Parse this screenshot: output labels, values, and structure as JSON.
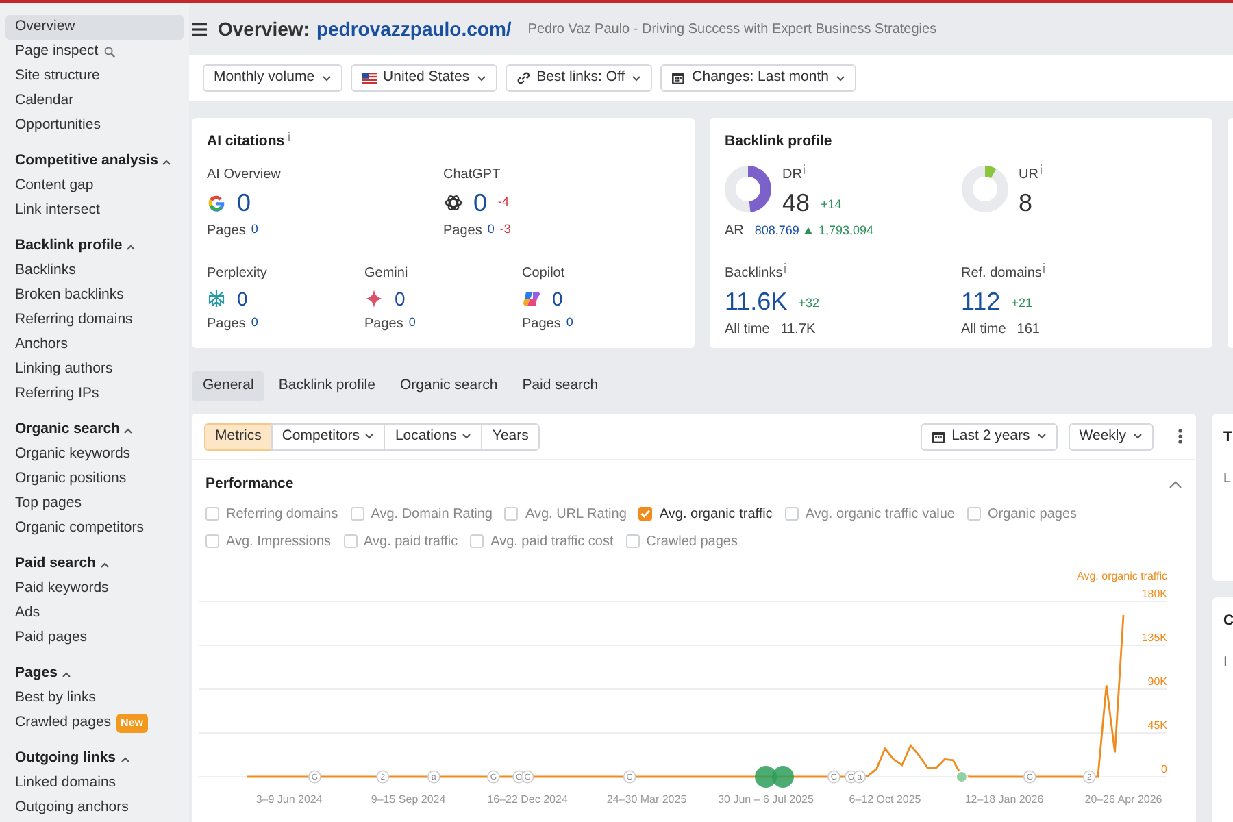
{
  "sidebar": {
    "groups": [
      {
        "items": [
          {
            "label": "Overview",
            "selected": true,
            "kind": "link"
          },
          {
            "label": "Page inspect",
            "selected": false,
            "kind": "search_link"
          },
          {
            "label": "Site structure",
            "selected": false,
            "kind": "link"
          },
          {
            "label": "Calendar",
            "selected": false,
            "kind": "link"
          },
          {
            "label": "Opportunities",
            "selected": false,
            "kind": "link"
          }
        ]
      },
      {
        "title": "Competitive analysis",
        "expanded": true,
        "items": [
          {
            "label": "Content gap",
            "selected": false,
            "kind": "link"
          },
          {
            "label": "Link intersect",
            "selected": false,
            "kind": "link"
          }
        ]
      },
      {
        "title": "Backlink profile",
        "expanded": true,
        "items": [
          {
            "label": "Backlinks",
            "selected": false,
            "kind": "link"
          },
          {
            "label": "Broken backlinks",
            "selected": false,
            "kind": "link"
          },
          {
            "label": "Referring domains",
            "selected": false,
            "kind": "link"
          },
          {
            "label": "Anchors",
            "selected": false,
            "kind": "link"
          },
          {
            "label": "Linking authors",
            "selected": false,
            "kind": "link"
          },
          {
            "label": "Referring IPs",
            "selected": false,
            "kind": "link"
          }
        ]
      },
      {
        "title": "Organic search",
        "expanded": true,
        "items": [
          {
            "label": "Organic keywords",
            "selected": false,
            "kind": "link"
          },
          {
            "label": "Organic positions",
            "selected": false,
            "kind": "link"
          },
          {
            "label": "Top pages",
            "selected": false,
            "kind": "link"
          },
          {
            "label": "Organic competitors",
            "selected": false,
            "kind": "link"
          }
        ]
      },
      {
        "title": "Paid search",
        "expanded": true,
        "items": [
          {
            "label": "Paid keywords",
            "selected": false,
            "kind": "link"
          },
          {
            "label": "Ads",
            "selected": false,
            "kind": "link"
          },
          {
            "label": "Paid pages",
            "selected": false,
            "kind": "link"
          }
        ]
      },
      {
        "title": "Pages",
        "expanded": true,
        "items": [
          {
            "label": "Best by links",
            "selected": false,
            "kind": "link"
          },
          {
            "label": "Crawled pages",
            "selected": false,
            "kind": "link",
            "badge": "New"
          }
        ]
      },
      {
        "title": "Outgoing links",
        "expanded": true,
        "items": [
          {
            "label": "Linked domains",
            "selected": false,
            "kind": "link"
          },
          {
            "label": "Outgoing anchors",
            "selected": false,
            "kind": "link"
          }
        ]
      }
    ]
  },
  "header": {
    "title": "Overview:",
    "domain": "pedrovazzpaulo.com/",
    "subtitle": "Pedro Vaz Paulo - Driving Success with Expert Business Strategies"
  },
  "filters": [
    {
      "label": "Monthly volume",
      "kind": "plain"
    },
    {
      "label": "United States",
      "kind": "flag"
    },
    {
      "label": "Best links: Off",
      "kind": "link"
    },
    {
      "label": "Changes: Last month",
      "kind": "calendar"
    }
  ],
  "ai_citations": {
    "title": "AI citations",
    "sources": [
      {
        "name": "AI Overview",
        "kind": "google",
        "value": "0",
        "pages_label": "Pages",
        "pages": "0"
      },
      {
        "name": "ChatGPT",
        "kind": "chatgpt",
        "value": "0",
        "delta": "-4",
        "pages_label": "Pages",
        "pages": "0",
        "pages_delta": "-3"
      },
      {
        "name": "Perplexity",
        "kind": "perplexity",
        "value": "0",
        "pages_label": "Pages",
        "pages": "0"
      },
      {
        "name": "Gemini",
        "kind": "gemini",
        "value": "0",
        "pages_label": "Pages",
        "pages": "0"
      },
      {
        "name": "Copilot",
        "kind": "copilot",
        "value": "0",
        "pages_label": "Pages",
        "pages": "0"
      }
    ]
  },
  "backlink_profile": {
    "title": "Backlink profile",
    "ratings": [
      {
        "label": "DR",
        "value": "48",
        "delta": "+14",
        "level": 0.48,
        "color": "#7b61c9"
      },
      {
        "label": "UR",
        "value": "8",
        "level": 0.08,
        "color": "#8cc63f"
      }
    ],
    "ar": {
      "label": "AR",
      "value": "808,769",
      "delta": "1,793,094"
    },
    "stats": [
      {
        "label": "Backlinks",
        "value": "11.6K",
        "delta": "+32",
        "all_time_label": "All time",
        "all_time": "11.7K"
      },
      {
        "label": "Ref. domains",
        "value": "112",
        "delta": "+21",
        "all_time_label": "All time",
        "all_time": "161"
      }
    ]
  },
  "tabs": [
    {
      "label": "General",
      "selected": true
    },
    {
      "label": "Backlink profile",
      "selected": false
    },
    {
      "label": "Organic search",
      "selected": false
    },
    {
      "label": "Paid search",
      "selected": false
    }
  ],
  "performance": {
    "segments": [
      {
        "label": "Metrics",
        "selected": true,
        "dropdown": false
      },
      {
        "label": "Competitors",
        "selected": false,
        "dropdown": true
      },
      {
        "label": "Locations",
        "selected": false,
        "dropdown": true
      },
      {
        "label": "Years",
        "selected": false,
        "dropdown": false
      }
    ],
    "controls": [
      {
        "label": "Last 2 years",
        "kind": "calendar"
      },
      {
        "label": "Weekly",
        "kind": "plain"
      }
    ],
    "title": "Performance",
    "expanded": true,
    "metrics": [
      {
        "label": "Referring domains",
        "checked": false
      },
      {
        "label": "Avg. Domain Rating",
        "checked": false
      },
      {
        "label": "Avg. URL Rating",
        "checked": false
      },
      {
        "label": "Avg. organic traffic",
        "checked": true
      },
      {
        "label": "Avg. organic traffic value",
        "checked": false
      },
      {
        "label": "Organic pages",
        "checked": false
      },
      {
        "label": "Avg. Impressions",
        "checked": false
      },
      {
        "label": "Avg. paid traffic",
        "checked": false
      },
      {
        "label": "Avg. paid traffic cost",
        "checked": false
      },
      {
        "label": "Crawled pages",
        "checked": false
      }
    ],
    "point_events": [
      {
        "kind": "marker",
        "label": "G"
      },
      {
        "kind": "marker",
        "label": "2"
      },
      {
        "kind": "marker",
        "label": "a"
      },
      {
        "kind": "marker",
        "label": "G"
      },
      {
        "kind": "marker",
        "label": "G"
      },
      {
        "kind": "marker",
        "label": "G"
      },
      {
        "kind": "marker",
        "label": "G"
      },
      {
        "kind": "dot_large"
      },
      {
        "kind": "dot_large"
      },
      {
        "kind": "marker",
        "label": "G"
      },
      {
        "kind": "marker",
        "label": "G"
      },
      {
        "kind": "marker",
        "label": "a"
      },
      {
        "kind": "dot"
      },
      {
        "kind": "marker",
        "label": "G"
      },
      {
        "kind": "marker",
        "label": "2"
      }
    ],
    "chart_data": {
      "type": "line",
      "grid": true,
      "categories": [
        null,
        null,
        null,
        null,
        null,
        "3–9 Jun 2024",
        null,
        null,
        null,
        null,
        null,
        null,
        null,
        null,
        null,
        null,
        null,
        null,
        null,
        "9–15 Sep 2024",
        null,
        null,
        null,
        null,
        null,
        null,
        null,
        null,
        null,
        null,
        null,
        null,
        null,
        "16–22 Dec 2024",
        null,
        null,
        null,
        null,
        null,
        null,
        null,
        null,
        null,
        null,
        null,
        null,
        null,
        "24–30 Mar 2025",
        null,
        null,
        null,
        null,
        null,
        null,
        null,
        null,
        null,
        null,
        null,
        null,
        null,
        "30 Jun – 6 Jul 2025",
        null,
        null,
        null,
        null,
        null,
        null,
        null,
        null,
        null,
        null,
        null,
        null,
        null,
        "6–12 Oct 2025",
        null,
        null,
        null,
        null,
        null,
        null,
        null,
        null,
        null,
        null,
        null,
        null,
        null,
        "12–18 Jan 2026",
        null,
        null,
        null,
        null,
        null,
        null,
        null,
        null,
        null,
        null,
        null,
        null,
        null,
        "20–26 Apr 2026"
      ],
      "series": [
        {
          "name": "Avg. organic traffic",
          "color": "#f08c1e",
          "values": [
            0,
            0,
            0,
            0,
            0,
            0,
            0,
            0,
            0,
            0,
            0,
            0,
            0,
            0,
            0,
            0,
            0,
            0,
            0,
            0,
            0,
            0,
            0,
            0,
            0,
            0,
            0,
            0,
            0,
            0,
            0,
            0,
            0,
            0,
            0,
            0,
            0,
            0,
            0,
            0,
            0,
            0,
            0,
            0,
            0,
            0,
            0,
            0,
            0,
            0,
            0,
            0,
            0,
            0,
            0,
            0,
            0,
            0,
            0,
            0,
            0,
            0,
            0,
            0,
            0,
            0,
            0,
            0,
            0,
            0,
            0,
            0,
            0,
            1000,
            8000,
            29000,
            18000,
            12000,
            32000,
            22000,
            9000,
            9000,
            18000,
            17000,
            1000,
            0,
            0,
            0,
            0,
            0,
            0,
            0,
            0,
            0,
            0,
            0,
            0,
            0,
            0,
            0,
            0,
            94000,
            25000,
            166000
          ]
        }
      ],
      "yticks": [
        {
          "value": 0,
          "label": "0"
        },
        {
          "value": 45000,
          "label": "45K"
        },
        {
          "value": 90000,
          "label": "90K"
        },
        {
          "value": 135000,
          "label": "135K"
        },
        {
          "value": 180000,
          "label": "180K"
        }
      ],
      "ylim": [
        0,
        180000
      ]
    }
  },
  "right_panels": [
    {
      "lines": [
        "T",
        "L"
      ]
    },
    {
      "lines": [
        "C",
        "I"
      ]
    }
  ]
}
